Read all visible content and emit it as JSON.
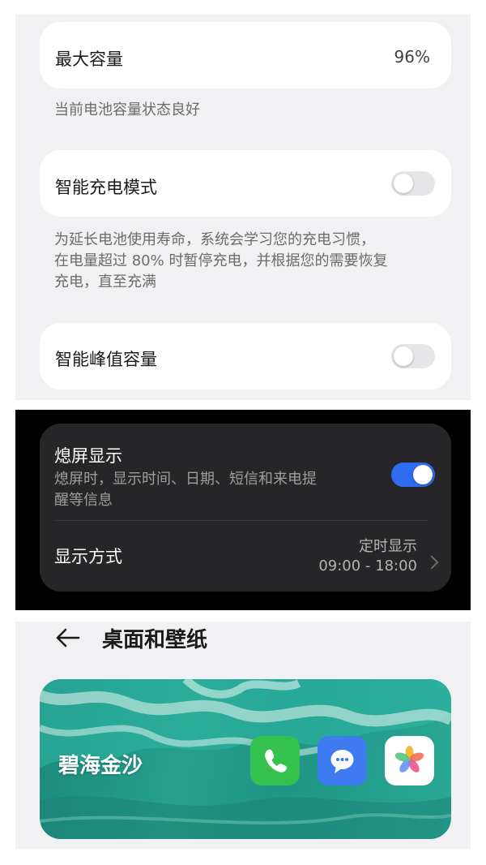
{
  "battery": {
    "max_capacity": {
      "label": "最大容量",
      "value": "96%"
    },
    "capacity_note": "当前电池容量状态良好",
    "smart_charging": {
      "label": "智能充电模式",
      "enabled": false
    },
    "smart_charging_note_lines": [
      "为延长电池使用寿命，系统会学习您的充电习惯，",
      "在电量超过 80% 时暂停充电，并根据您的需要恢复",
      "充电，直至充满"
    ],
    "smart_peak_capacity": {
      "label": "智能峰值容量",
      "enabled": false
    }
  },
  "always_on_display": {
    "title": "熄屏显示",
    "description_lines": [
      "熄屏时，显示时间、日期、短信和来电提",
      "醒等信息"
    ],
    "enabled": true,
    "display_mode": {
      "label": "显示方式",
      "value_line1": "定时显示",
      "value_line2": "09:00 - 18:00"
    }
  },
  "desktop_wallpaper": {
    "title": "桌面和壁纸",
    "wallpaper_name": "碧海金沙",
    "apps": [
      "phone-app-icon",
      "messages-app-icon",
      "photos-app-icon"
    ]
  },
  "colors": {
    "toggle_on": "#2f6cf2",
    "phone": "#35c14e",
    "messages": "#3e7bf0"
  }
}
